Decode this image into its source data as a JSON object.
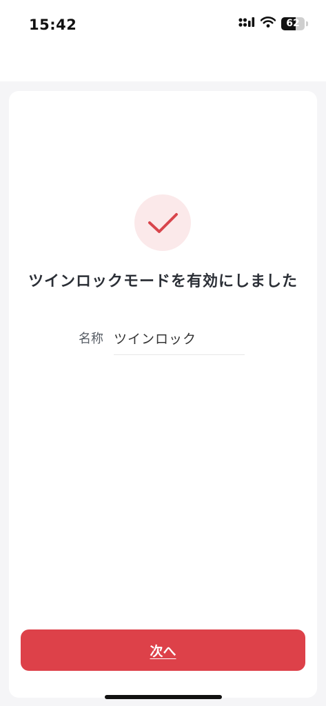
{
  "status_bar": {
    "time": "15:42",
    "battery_level": "62",
    "icons": [
      "cellular-signal-icon",
      "wifi-icon",
      "battery-icon"
    ]
  },
  "success": {
    "icon": "checkmark-icon",
    "title": "ツインロックモードを有効にしました"
  },
  "form": {
    "name_label": "名称",
    "name_value": "ツインロック"
  },
  "footer": {
    "next_label": "次へ"
  },
  "colors": {
    "accent": "#dd4149",
    "accent_soft": "#fbe9ea",
    "page_background": "#f5f5f7",
    "card_background": "#ffffff",
    "title_text": "#2b2f36"
  }
}
